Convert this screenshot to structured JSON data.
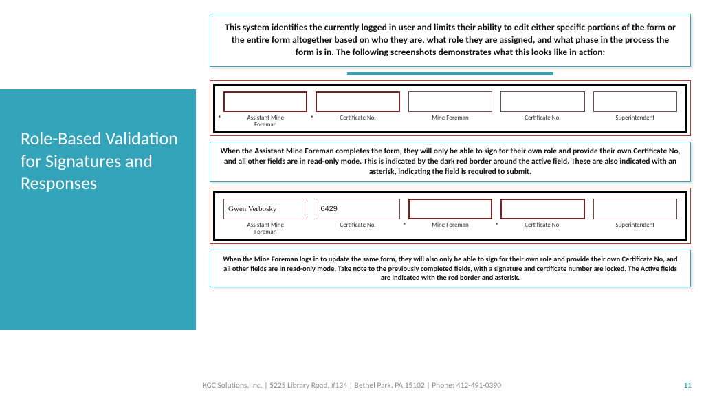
{
  "side_title": "Role-Based Validation for Signatures and Responses",
  "intro": "This system identifies the currently logged in user and limits their ability to edit either specific portions of the form or the entire form altogether based on who they are, what role they are assigned, and what phase in the process the form is in. The following screenshots demonstrates what this looks like in action:",
  "shot1": {
    "fields": [
      {
        "label": "Assistant Mine\nForeman",
        "value": "",
        "active": true,
        "asterisk": true
      },
      {
        "label": "Certificate No.",
        "value": "",
        "active": true,
        "asterisk": true
      },
      {
        "label": "Mine Foreman",
        "value": "",
        "active": false,
        "asterisk": false
      },
      {
        "label": "Certificate No.",
        "value": "",
        "active": false,
        "asterisk": false
      },
      {
        "label": "Superintendent",
        "value": "",
        "active": false,
        "asterisk": false
      }
    ]
  },
  "mid": "When the Assistant Mine Foreman completes the form, they will only be able to sign for their own role and provide their own Certificate No, and all other fields are in read-only mode.  This is indicated by the dark red border around the active field.  These are also indicated with an asterisk, indicating the field is required to submit.",
  "shot2": {
    "fields": [
      {
        "label": "Assistant Mine\nForeman",
        "value": "Gwen Verbosky",
        "sig": true,
        "active": false,
        "asterisk": false
      },
      {
        "label": "Certificate No.",
        "value": "6429",
        "sig": false,
        "active": false,
        "asterisk": false
      },
      {
        "label": "Mine Foreman",
        "value": "",
        "sig": false,
        "active": true,
        "asterisk": true
      },
      {
        "label": "Certificate No.",
        "value": "",
        "sig": false,
        "active": true,
        "asterisk": true
      },
      {
        "label": "Superintendent",
        "value": "",
        "sig": false,
        "active": false,
        "asterisk": false
      }
    ]
  },
  "end": "When the Mine Foreman logs in to update the same form, they will also only be able to sign for their own role and provide their own Certificate No, and all other fields are in read-only mode.  Take note to the previously completed fields, with a signature and certificate number are locked.  The Active fields are indicated with the red border and asterisk.",
  "footer": "KGC Solutions, Inc. | 5225 Library Road, #134 | Bethel Park, PA  15102 | Phone: 412-491-0390",
  "page": "11"
}
